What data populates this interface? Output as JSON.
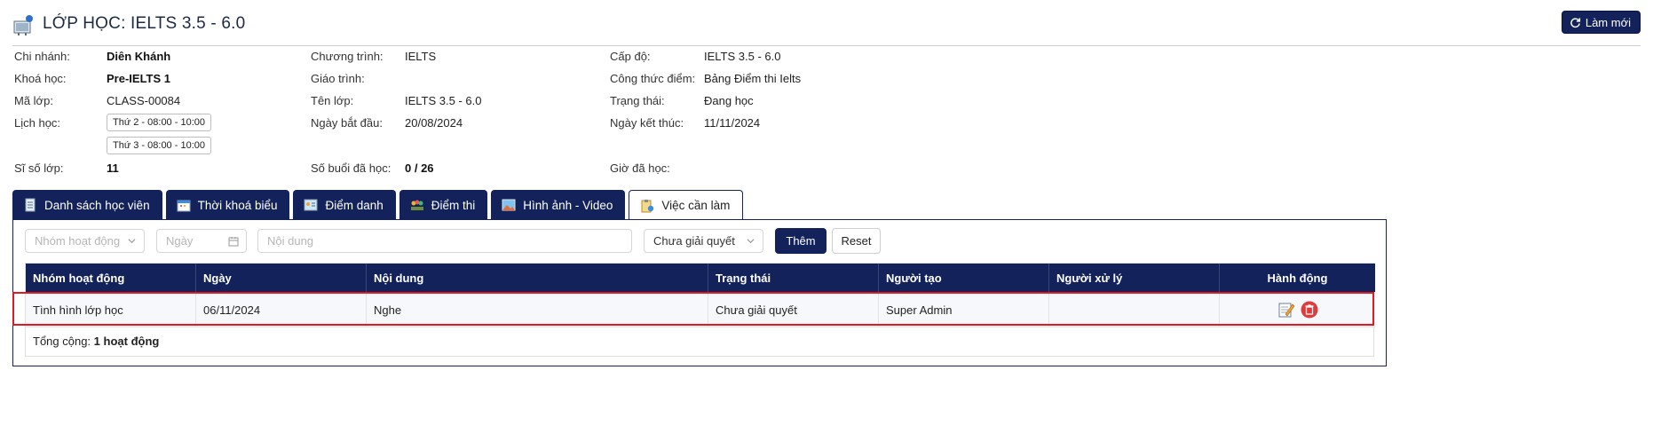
{
  "header": {
    "title": "LỚP HỌC: IELTS 3.5 - 6.0",
    "refresh_label": "Làm mới",
    "title_icon": "classroom-icon",
    "refresh_icon": "refresh-icon"
  },
  "info": {
    "branch": {
      "label": "Chi nhánh:",
      "value": "Diên Khánh"
    },
    "course": {
      "label": "Khoá học:",
      "value": "Pre-IELTS 1"
    },
    "class_code": {
      "label": "Mã lớp:",
      "value": "CLASS-00084"
    },
    "schedule": {
      "label": "Lịch học:",
      "items": [
        "Thứ 2 - 08:00 - 10:00",
        "Thứ 3 - 08:00 - 10:00"
      ]
    },
    "class_size": {
      "label": "Sĩ số lớp:",
      "value": "11"
    },
    "program": {
      "label": "Chương trình:",
      "value": "IELTS"
    },
    "curriculum": {
      "label": "Giáo trình:",
      "value": ""
    },
    "class_name": {
      "label": "Tên lớp:",
      "value": "IELTS 3.5 - 6.0"
    },
    "start_date": {
      "label": "Ngày bắt đầu:",
      "value": "20/08/2024"
    },
    "sessions": {
      "label": "Số buổi đã học:",
      "value": "0 / 26"
    },
    "level": {
      "label": "Cấp độ:",
      "value": "IELTS 3.5 - 6.0"
    },
    "score_formula": {
      "label": "Công thức điểm:",
      "value": "Bảng Điểm thi Ielts"
    },
    "status": {
      "label": "Trạng thái:",
      "value": "Đang học"
    },
    "end_date": {
      "label": "Ngày kết thúc:",
      "value": "11/11/2024"
    },
    "hours": {
      "label": "Giờ đã học:",
      "value": ""
    }
  },
  "tabs": [
    {
      "label": "Danh sách học viên",
      "icon": "student-list-icon",
      "active": false
    },
    {
      "label": "Thời khoá biểu",
      "icon": "calendar-icon",
      "active": false
    },
    {
      "label": "Điểm danh",
      "icon": "attendance-icon",
      "active": false
    },
    {
      "label": "Điểm thi",
      "icon": "exam-score-icon",
      "active": false
    },
    {
      "label": "Hình ảnh - Video",
      "icon": "image-icon",
      "active": false
    },
    {
      "label": "Việc cần làm",
      "icon": "todo-icon",
      "active": true
    }
  ],
  "filters": {
    "group_placeholder": "Nhóm hoạt động",
    "date_placeholder": "Ngày",
    "content_placeholder": "Nội dung",
    "status_value": "Chưa giải quyết",
    "add_label": "Thêm",
    "reset_label": "Reset"
  },
  "table": {
    "columns": [
      "Nhóm hoạt động",
      "Ngày",
      "Nội dung",
      "Trạng thái",
      "Người tạo",
      "Người xử lý",
      "Hành động"
    ],
    "rows": [
      {
        "group": "Tình hình lớp học",
        "date": "06/11/2024",
        "content": "Nghe",
        "status": "Chưa giải quyết",
        "creator": "Super Admin",
        "handler": ""
      }
    ],
    "total_prefix": "Tổng cộng:",
    "total_value": "1 hoạt động"
  },
  "colors": {
    "primary": "#13225a",
    "highlight": "#e01a22",
    "delete": "#e03a3a"
  }
}
